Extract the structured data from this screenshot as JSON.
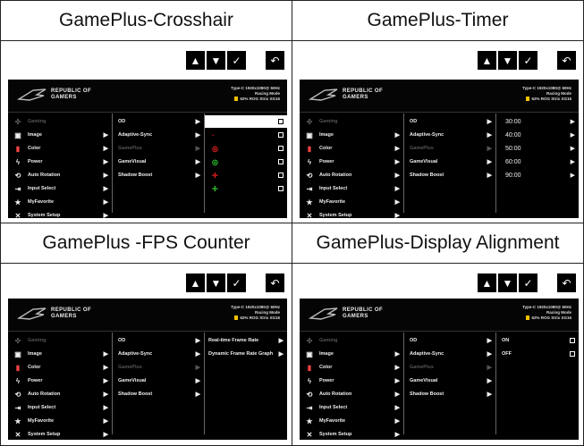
{
  "panels": [
    {
      "title": "GamePlus-Crosshair",
      "brand_line1": "REPUBLIC OF",
      "brand_line2": "GAMERS",
      "status": [
        "Type-C 1920x1080@ 60Hz",
        "Racing Mode",
        "62% ROG Strix XG16"
      ],
      "menu": [
        "Gaming",
        "Image",
        "Color",
        "Power",
        "Auto Rotation",
        "Input Select",
        "MyFavorite",
        "System Setup"
      ],
      "sub": [
        "OD",
        "Adaptive-Sync",
        "GamePlus",
        "GameVisual",
        "Shadow Boost"
      ],
      "third": [
        "",
        "·",
        "◎",
        "◎",
        "✛",
        "✛"
      ]
    },
    {
      "title": "GamePlus-Timer",
      "brand_line1": "REPUBLIC OF",
      "brand_line2": "GAMERS",
      "status": [
        "Type-C 1920x1080@ 60Hz",
        "Racing Mode",
        "62% ROG Strix XG16"
      ],
      "menu": [
        "Gaming",
        "Image",
        "Color",
        "Power",
        "Auto Rotation",
        "Input Select",
        "MyFavorite",
        "System Setup"
      ],
      "sub": [
        "OD",
        "Adaptive-Sync",
        "GamePlus",
        "GameVisual",
        "Shadow Boost"
      ],
      "third": [
        "30:00",
        "40:00",
        "50:00",
        "60:00",
        "90:00"
      ]
    },
    {
      "title": "GamePlus -FPS Counter",
      "brand_line1": "REPUBLIC OF",
      "brand_line2": "GAMERS",
      "status": [
        "Type-C 1920x1080@ 60Hz",
        "Racing Mode",
        "62% ROG Strix XG16"
      ],
      "menu": [
        "Gaming",
        "Image",
        "Color",
        "Power",
        "Auto Rotation",
        "Input Select",
        "MyFavorite",
        "System Setup"
      ],
      "sub": [
        "OD",
        "Adaptive-Sync",
        "GamePlus",
        "GameVisual",
        "Shadow Boost"
      ],
      "third": [
        "Real-time Frame Rate",
        "Dynamic Frame Rate Graph"
      ]
    },
    {
      "title": "GamePlus-Display Alignment",
      "brand_line1": "REPUBLIC OF",
      "brand_line2": "GAMERS",
      "status": [
        "Type-C 1920x1080@ 60Hz",
        "Racing Mode",
        "62% ROG Strix XG16"
      ],
      "menu": [
        "Gaming",
        "Image",
        "Color",
        "Power",
        "Auto Rotation",
        "Input Select",
        "MyFavorite",
        "System Setup"
      ],
      "sub": [
        "OD",
        "Adaptive-Sync",
        "GamePlus",
        "GameVisual",
        "Shadow Boost"
      ],
      "third": [
        "ON",
        "OFF"
      ]
    }
  ],
  "toolbar": {
    "up": "▲",
    "down": "▼",
    "ok": "✓",
    "back": "↶"
  },
  "icons": [
    "gamepad-icon",
    "image-icon",
    "color-icon",
    "power-icon",
    "rotation-icon",
    "input-icon",
    "star-icon",
    "wrench-icon"
  ],
  "colors": {
    "crosshair_red": "#e22222",
    "crosshair_green": "#3ccd3c",
    "status_bar": "#f4c000"
  }
}
